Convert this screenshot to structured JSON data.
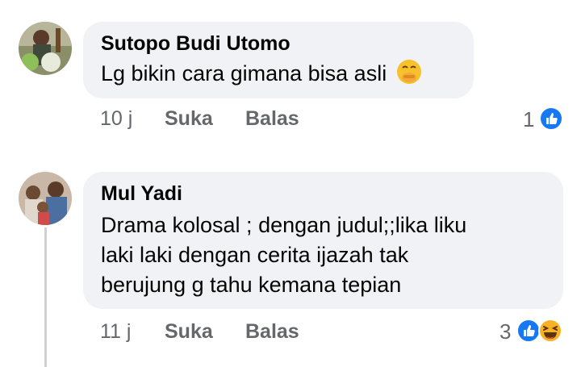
{
  "comments": [
    {
      "author": "Sutopo Budi Utomo",
      "text": "Lg bikin cara gimana bisa asli",
      "emoji": "face-with-hand-over-mouth",
      "time": "10 j",
      "like_label": "Suka",
      "reply_label": "Balas",
      "reaction_count": "1",
      "reactions": [
        "like-icon"
      ]
    },
    {
      "author": "Mul Yadi",
      "text_lines": [
        "Drama kolosal ; dengan judul;;lika liku",
        "laki laki dengan cerita ijazah tak",
        "berujung g tahu kemana tepian"
      ],
      "time": "11 j",
      "like_label": "Suka",
      "reply_label": "Balas",
      "reaction_count": "3",
      "reactions": [
        "like-icon",
        "haha-icon"
      ]
    }
  ],
  "colors": {
    "bubble": "#f0f2f5",
    "meta_text": "#65676b",
    "like_blue": "#1877f2",
    "haha_yellow": "#f7b125"
  }
}
